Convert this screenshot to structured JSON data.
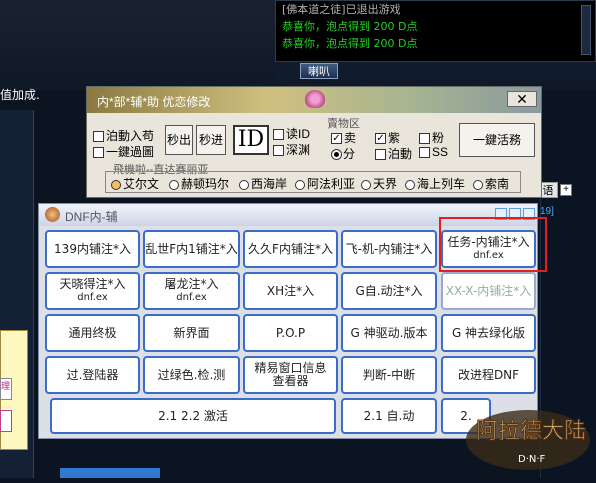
{
  "chat": {
    "line1": "[佛本道之徒]已退出游戏",
    "line2": "恭喜你，泡点得到 200 D点",
    "line3": "恭喜你，泡点得到 200 D点",
    "tab_label": "喇叭"
  },
  "left_message": "值加成.",
  "right_panel": {
    "tab": "语",
    "plus": "+",
    "num": "19]"
  },
  "tool": {
    "title": "内*部*辅*助 优恋修改",
    "close": "✕",
    "checks": {
      "auto_shop": "泊動入苟",
      "one_key": "一鍵過圖",
      "read_id": "读ID",
      "deep_sea": "深渊"
    },
    "buttons": {
      "miao_out": "秒出",
      "miao_in": "秒进",
      "id": "ID",
      "one_key_task": "一鍵活務"
    },
    "sell_group": "賣物区",
    "sell_opts": {
      "sell": "卖",
      "split": "分",
      "purple": "紫",
      "auto_pickup": "泊動",
      "pink": "粉",
      "ss": "SS"
    },
    "server_group": "飛機啦--直达赛丽亚",
    "servers": [
      "艾尔文",
      "赫顿玛尔",
      "西海岸",
      "阿法利亚",
      "天界",
      "海上列车",
      "索南"
    ]
  },
  "dnf": {
    "title": "DNF内-辅",
    "buttons": [
      {
        "label": "139内铺注*入",
        "sub": ""
      },
      {
        "label": "乱世F内1铺注*入",
        "sub": ""
      },
      {
        "label": "久久F内铺注*入",
        "sub": ""
      },
      {
        "label": "飞-机-内铺注*入",
        "sub": ""
      },
      {
        "label": "任务-内铺注*入",
        "sub": "dnf.ex"
      },
      {
        "label": "天晓得注*入",
        "sub": "dnf.ex"
      },
      {
        "label": "屠龙注*入",
        "sub": "dnf.ex"
      },
      {
        "label": "XH注*入",
        "sub": ""
      },
      {
        "label": "G自.动注*入",
        "sub": ""
      },
      {
        "label": "XX-X-内铺注*入",
        "sub": ""
      },
      {
        "label": "通用终极",
        "sub": ""
      },
      {
        "label": "新界面",
        "sub": ""
      },
      {
        "label": "P.O.P",
        "sub": ""
      },
      {
        "label": "G 神驱动.版本",
        "sub": ""
      },
      {
        "label": "G 神去绿化版",
        "sub": ""
      },
      {
        "label": "过.登陆器",
        "sub": ""
      },
      {
        "label": "过绿色.检.测",
        "sub": ""
      },
      {
        "label": "精易窗口信息查看器",
        "sub": ""
      },
      {
        "label": "判断-中断",
        "sub": ""
      },
      {
        "label": "改进程DNF",
        "sub": ""
      },
      {
        "label": "2.1 2.2 激活",
        "sub": ""
      },
      {
        "label": "2.1 自.动",
        "sub": ""
      },
      {
        "label": "2.",
        "sub": ""
      }
    ]
  },
  "logo": {
    "text": "阿拉德大陆",
    "sub": "D·N·F"
  }
}
